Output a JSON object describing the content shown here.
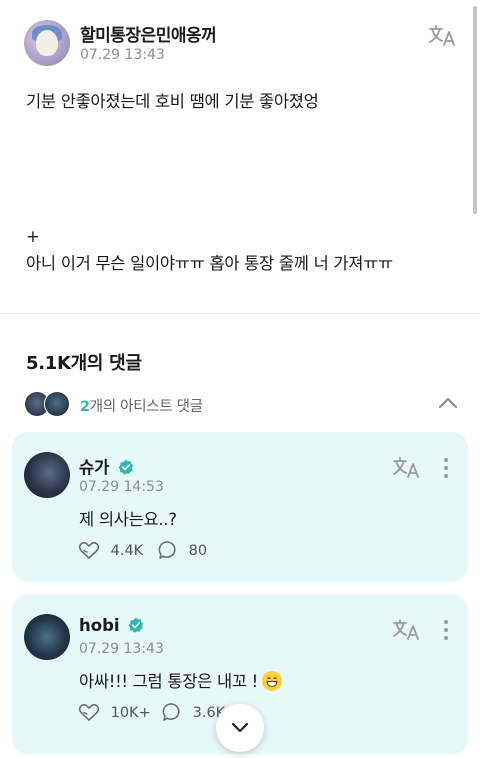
{
  "post": {
    "author": "할미통장은민애옹꺼",
    "timestamp": "07.29 13:43",
    "body": "기분 안좋아졌는데 호비 땜에 기분 좋아졌엉\n\n\n\n\n+\n아니 이거 무슨 일이야ㅠㅠ 홉아 통장 줄께 너 가져ㅠㅠ"
  },
  "comments_section": {
    "title": "5.1K개의 댓글",
    "artist_count": "2",
    "artist_suffix": "개의 아티스트 댓글"
  },
  "comments": [
    {
      "name": "슈가",
      "timestamp": "07.29 14:53",
      "text": "제 의사는요..?",
      "likes": "4.4K",
      "replies": "80"
    },
    {
      "name": "hobi",
      "timestamp": "07.29 13:43",
      "text": "아싸!!! 그럼 통장은 내꼬 !",
      "likes": "10K+",
      "replies": "3.6K"
    }
  ],
  "icons": {
    "translate": "translate-icon",
    "verified": "verified-badge-icon",
    "like": "like-icon",
    "reply": "reply-icon",
    "more": "more-vertical-icon",
    "chevron_up": "chevron-up-icon",
    "chevron_down": "chevron-down-icon"
  },
  "colors": {
    "accent": "#2bb8b0",
    "card_bg": "#e6f8f7"
  }
}
